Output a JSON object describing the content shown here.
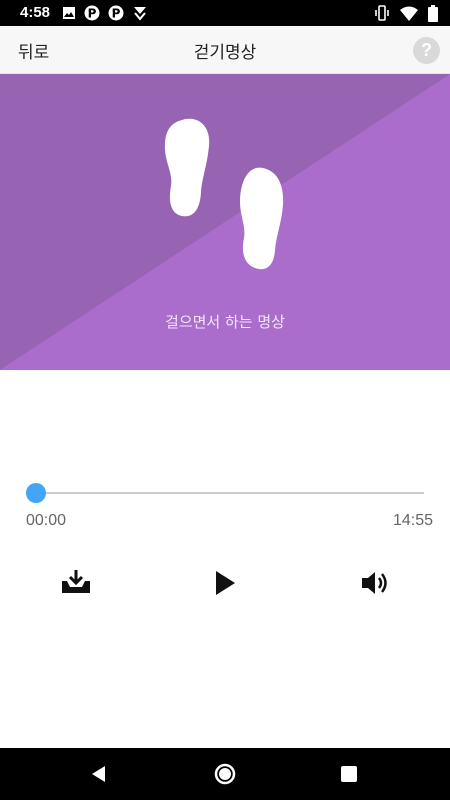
{
  "status_bar": {
    "time": "4:58",
    "left_icons": [
      "image-icon",
      "p-icon",
      "p-icon",
      "cast-icon"
    ],
    "right_icons": [
      "vibrate-icon",
      "wifi-icon",
      "battery-icon"
    ]
  },
  "header": {
    "back_label": "뒤로",
    "title": "걷기명상",
    "help_label": "?"
  },
  "banner": {
    "caption": "걸으면서 하는 명상",
    "icon": "footprints-icon",
    "color_dark": "#9764b3",
    "color_light": "#aa6dcb"
  },
  "player": {
    "current_time": "00:00",
    "total_time": "14:55",
    "progress": 0,
    "accent": "#42a5f5",
    "controls": [
      "download-icon",
      "play-icon",
      "volume-icon"
    ]
  },
  "nav_bar": {
    "buttons": [
      "back-icon",
      "home-icon",
      "recents-icon"
    ]
  }
}
